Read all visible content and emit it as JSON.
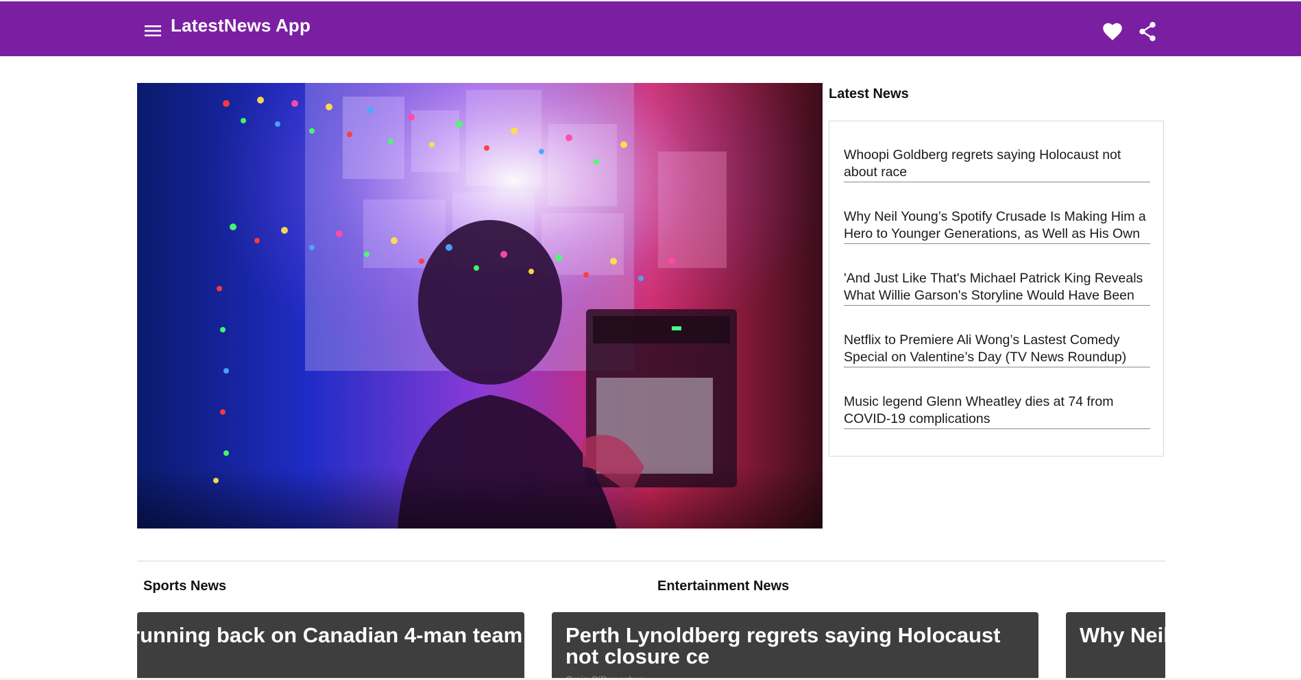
{
  "app_bar": {
    "title": "LatestNews App",
    "background_color": "#7b1fa2",
    "menu_icon": "menu-icon",
    "favorite_icon": "heart-icon",
    "share_icon": "share-icon"
  },
  "hero": {
    "image": "person-watching-tv-under-string-lights"
  },
  "latest": {
    "title": "Latest News",
    "items": [
      {
        "title": "Whoopi Goldberg regrets saying Holocaust not about race"
      },
      {
        "title": "Why Neil Young’s Spotify Crusade Is Making Him a Hero to Younger Generations, as Well as His Own"
      },
      {
        "title": "'And Just Like That's Michael Patrick King Reveals What Willie Garson's Storyline Would Have Been"
      },
      {
        "title": "Netflix to Premiere Ali Wong’s Lastest Comedy Special on Valentine’s Day (TV News Roundup)"
      },
      {
        "title": "Music legend Glenn Wheatley dies at 74 from COVID-19 complications"
      }
    ]
  },
  "sections": {
    "sports_title": "Sports News",
    "entertainment_title": "Entertainment News"
  },
  "cards": {
    "sports": {
      "title": "running back on Canadian 4-man team"
    },
    "entertainment": {
      "title": "Perth Lynoldberg regrets saying Holocaust not closure ce",
      "byline": "Craig O'Donoghue"
    },
    "third": {
      "title": "Why Neil a Hero to Own"
    }
  }
}
